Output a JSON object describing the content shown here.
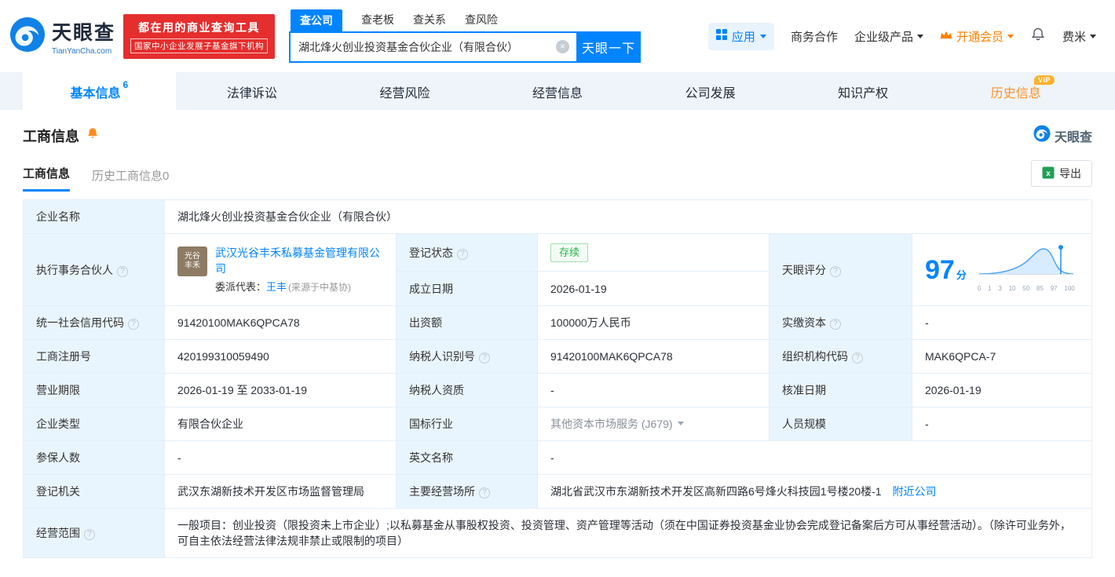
{
  "brand": {
    "name": "天眼查",
    "domain": "TianYanCha.com",
    "slogan1": "都在用的商业查询工具",
    "slogan2": "国家中小企业发展子基金旗下机构"
  },
  "search": {
    "tabs": [
      {
        "label": "查公司"
      },
      {
        "label": "查老板"
      },
      {
        "label": "查关系"
      },
      {
        "label": "查风险"
      }
    ],
    "value": "湖北烽火创业投资基金合伙企业（有限合伙）",
    "button": "天眼一下"
  },
  "topnav": {
    "apps": "应用",
    "biz_coop": "商务合作",
    "enterprise": "企业级产品",
    "vip": "开通会员",
    "user": "费米"
  },
  "main_tabs": {
    "basic": "基本信息",
    "basic_count": "6",
    "legal": "法律诉讼",
    "risk": "经营风险",
    "operation": "经营信息",
    "development": "公司发展",
    "ip": "知识产权",
    "history": "历史信息",
    "vip_tag": "VIP"
  },
  "section": {
    "title": "工商信息",
    "brand": "天眼查",
    "tab_current": "工商信息",
    "tab_history": "历史工商信息0",
    "export": "导出"
  },
  "biz": {
    "company_name_label": "企业名称",
    "company_name": "湖北烽火创业投资基金合伙企业（有限合伙）",
    "partner_label": "执行事务合伙人",
    "partner_logo_line1": "光谷",
    "partner_logo_line2": "丰禾",
    "partner_name": "武汉光谷丰禾私募基金管理有限公司",
    "rep_label": "委派代表：",
    "rep_name": "王丰",
    "rep_source": "(来源于中基协)",
    "status_label": "登记状态",
    "status": "存续",
    "establish_label": "成立日期",
    "establish": "2026-01-19",
    "score_label": "天眼评分",
    "score": "97",
    "score_unit": "分",
    "score_axis": [
      "0",
      "1",
      "3",
      "10",
      "50",
      "85",
      "97",
      "100"
    ],
    "credit_code_label": "统一社会信用代码",
    "credit_code": "91420100MAK6QPCA78",
    "capital_label": "出资额",
    "capital": "100000万人民币",
    "paid_capital_label": "实缴资本",
    "paid_capital": "-",
    "reg_no_label": "工商注册号",
    "reg_no": "420199310059490",
    "tax_id_label": "纳税人识别号",
    "tax_id": "91420100MAK6QPCA78",
    "org_code_label": "组织机构代码",
    "org_code": "MAK6QPCA-7",
    "term_label": "营业期限",
    "term": "2026-01-19 至 2033-01-19",
    "tax_qual_label": "纳税人资质",
    "tax_qual": "-",
    "approval_label": "核准日期",
    "approval": "2026-01-19",
    "type_label": "企业类型",
    "type": "有限合伙企业",
    "industry_label": "国标行业",
    "industry": "其他资本市场服务 (J679)",
    "staff_label": "人员规模",
    "staff": "-",
    "insured_label": "参保人数",
    "insured": "-",
    "en_name_label": "英文名称",
    "en_name": "-",
    "authority_label": "登记机关",
    "authority": "武汉东湖新技术开发区市场监督管理局",
    "address_label": "主要经营场所",
    "address": "湖北省武汉市东湖新技术开发区高新四路6号烽火科技园1号楼20楼-1",
    "nearby": "附近公司",
    "scope_label": "经营范围",
    "scope": "一般项目：创业投资（限投资未上市企业）;以私募基金从事股权投资、投资管理、资产管理等活动（须在中国证券投资基金业协会完成登记备案后方可从事经营活动）。（除许可业务外，可自主依法经营法律法规非禁止或限制的项目）"
  }
}
